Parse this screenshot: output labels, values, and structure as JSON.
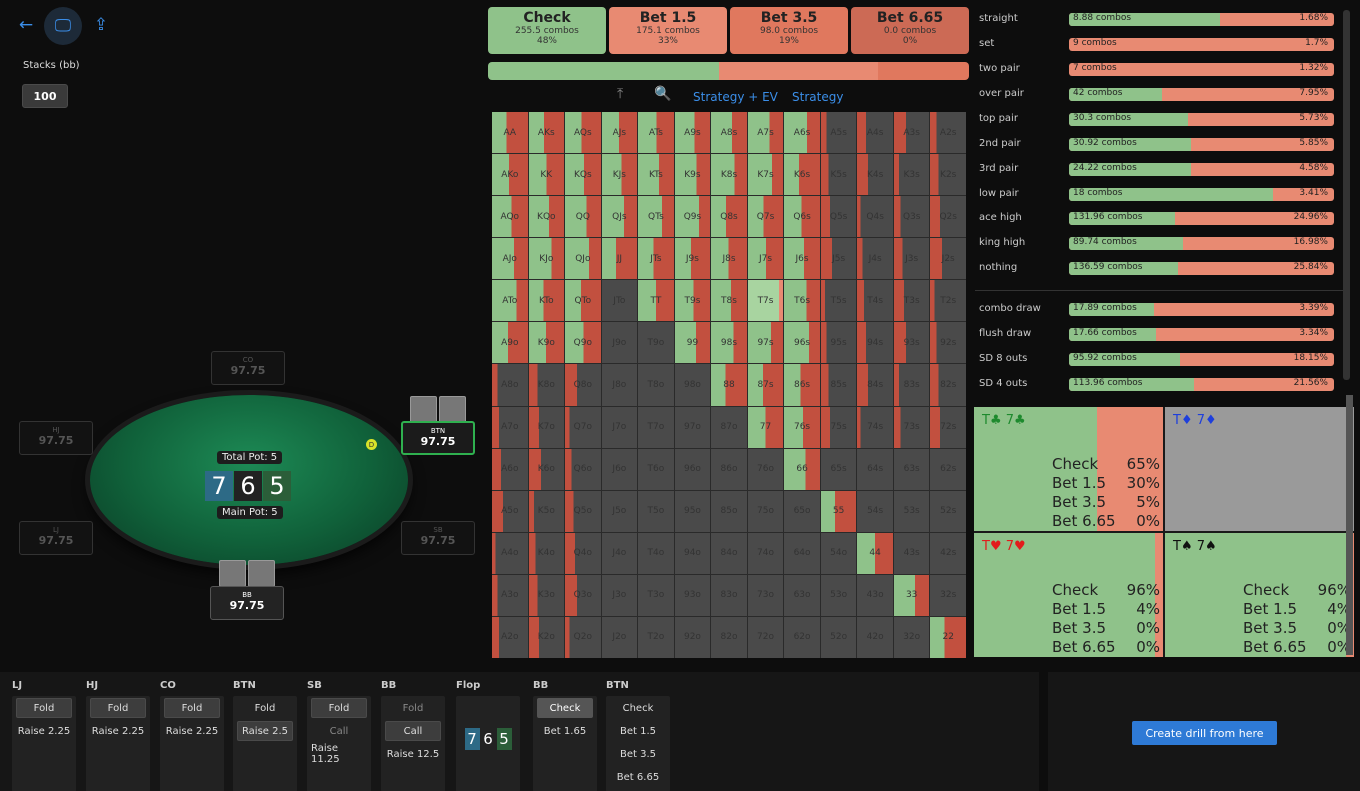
{
  "toolbar": {
    "back_icon": "←",
    "monitor_icon": "🖵",
    "export_icon": "⇪"
  },
  "stacks": {
    "label": "Stacks (bb)",
    "value": "100"
  },
  "table": {
    "total_pot": "Total Pot: 5",
    "main_pot": "Main Pot: 5",
    "board": [
      "7",
      "6",
      "5"
    ],
    "board_colors": [
      "#2d6a86",
      "#222",
      "#2b5e39"
    ],
    "dealer_icon": "D",
    "seats": [
      {
        "name": "CO",
        "stack": "97.75"
      },
      {
        "name": "HJ",
        "stack": "97.75"
      },
      {
        "name": "BTN",
        "stack": "97.75"
      },
      {
        "name": "LJ",
        "stack": "97.75"
      },
      {
        "name": "SB",
        "stack": "97.75"
      },
      {
        "name": "BB",
        "stack": "97.75"
      }
    ]
  },
  "actions": [
    {
      "name": "Check",
      "combos": "255.5 combos",
      "pct": "48%",
      "color": "#8fc28a"
    },
    {
      "name": "Bet 1.5",
      "combos": "175.1 combos",
      "pct": "33%",
      "color": "#e88a72"
    },
    {
      "name": "Bet 3.5",
      "combos": "98.0 combos",
      "pct": "19%",
      "color": "#e0785e"
    },
    {
      "name": "Bet 6.65",
      "combos": "0.0 combos",
      "pct": "0%",
      "color": "#cc6a55"
    }
  ],
  "strategy_bar": [
    0.48,
    0.33,
    0.19,
    0.0
  ],
  "view_tabs": {
    "pin_icon": "⤒",
    "zoom_icon": "🔍",
    "strategy_ev": "Strategy + EV",
    "strategy": "Strategy"
  },
  "matrix": {
    "ranks": [
      "A",
      "K",
      "Q",
      "J",
      "T",
      "9",
      "8",
      "7",
      "6",
      "5",
      "4",
      "3",
      "2"
    ],
    "green": "#8fc28a",
    "red": "#c2503f",
    "grey": "#4a4a4a"
  },
  "stats": [
    {
      "name": "straight",
      "combos": "8.88 combos",
      "pct": "1.68%",
      "check": 0.57
    },
    {
      "name": "set",
      "combos": "9 combos",
      "pct": "1.7%",
      "check": 0.0
    },
    {
      "name": "two pair",
      "combos": "7 combos",
      "pct": "1.32%",
      "check": 0.0
    },
    {
      "name": "over pair",
      "combos": "42 combos",
      "pct": "7.95%",
      "check": 0.35
    },
    {
      "name": "top pair",
      "combos": "30.3 combos",
      "pct": "5.73%",
      "check": 0.45
    },
    {
      "name": "2nd pair",
      "combos": "30.92 combos",
      "pct": "5.85%",
      "check": 0.46
    },
    {
      "name": "3rd pair",
      "combos": "24.22 combos",
      "pct": "4.58%",
      "check": 0.46
    },
    {
      "name": "low pair",
      "combos": "18 combos",
      "pct": "3.41%",
      "check": 0.77
    },
    {
      "name": "ace high",
      "combos": "131.96 combos",
      "pct": "24.96%",
      "check": 0.4
    },
    {
      "name": "king high",
      "combos": "89.74 combos",
      "pct": "16.98%",
      "check": 0.43
    },
    {
      "name": "nothing",
      "combos": "136.59 combos",
      "pct": "25.84%",
      "check": 0.41
    },
    {
      "name": "combo draw",
      "combos": "17.89 combos",
      "pct": "3.39%",
      "check": 0.32
    },
    {
      "name": "flush draw",
      "combos": "17.66 combos",
      "pct": "3.34%",
      "check": 0.33
    },
    {
      "name": "SD 8 outs",
      "combos": "95.92 combos",
      "pct": "18.15%",
      "check": 0.42
    },
    {
      "name": "SD 4 outs",
      "combos": "113.96 combos",
      "pct": "21.56%",
      "check": 0.47
    }
  ],
  "combo_detail": [
    {
      "rank1": "T",
      "rank2": "7",
      "suit": "♣",
      "color": "#1e8a2e",
      "lines": [
        {
          "a": "Check",
          "p": "65%"
        },
        {
          "a": "Bet 1.5",
          "p": "30%"
        },
        {
          "a": "Bet 3.5",
          "p": "5%"
        },
        {
          "a": "Bet 6.65",
          "p": "0%"
        }
      ],
      "red": 0.35,
      "grey": false
    },
    {
      "rank1": "T",
      "rank2": "7",
      "suit": "♦",
      "color": "#1e3fdc",
      "lines": [],
      "red": 0,
      "grey": true
    },
    {
      "rank1": "T",
      "rank2": "7",
      "suit": "♥",
      "color": "#e21c1c",
      "lines": [
        {
          "a": "Check",
          "p": "96%"
        },
        {
          "a": "Bet 1.5",
          "p": "4%"
        },
        {
          "a": "Bet 3.5",
          "p": "0%"
        },
        {
          "a": "Bet 6.65",
          "p": "0%"
        }
      ],
      "red": 0.04,
      "grey": false
    },
    {
      "rank1": "T",
      "rank2": "7",
      "suit": "♠",
      "color": "#111",
      "lines": [
        {
          "a": "Check",
          "p": "96%"
        },
        {
          "a": "Bet 1.5",
          "p": "4%"
        },
        {
          "a": "Bet 3.5",
          "p": "0%"
        },
        {
          "a": "Bet 6.65",
          "p": "0%"
        }
      ],
      "red": 0.04,
      "grey": false
    }
  ],
  "history": [
    {
      "pos": "LJ",
      "opts": [
        {
          "t": "Fold",
          "s": "sel"
        },
        {
          "t": "Raise 2.25",
          "s": ""
        }
      ]
    },
    {
      "pos": "HJ",
      "opts": [
        {
          "t": "Fold",
          "s": "sel"
        },
        {
          "t": "Raise 2.25",
          "s": ""
        }
      ]
    },
    {
      "pos": "CO",
      "opts": [
        {
          "t": "Fold",
          "s": "sel"
        },
        {
          "t": "Raise 2.25",
          "s": ""
        }
      ]
    },
    {
      "pos": "BTN",
      "opts": [
        {
          "t": "Fold",
          "s": ""
        },
        {
          "t": "Raise 2.5",
          "s": "sel"
        }
      ]
    },
    {
      "pos": "SB",
      "opts": [
        {
          "t": "Fold",
          "s": "sel"
        },
        {
          "t": "Call",
          "s": "dim"
        },
        {
          "t": "Raise 11.25",
          "s": ""
        }
      ]
    },
    {
      "pos": "BB",
      "opts": [
        {
          "t": "Fold",
          "s": "dim"
        },
        {
          "t": "Call",
          "s": "sel"
        },
        {
          "t": "Raise 12.5",
          "s": ""
        }
      ]
    },
    {
      "pos": "Flop",
      "opts": []
    },
    {
      "pos": "BB",
      "opts": [
        {
          "t": "Check",
          "s": "hi"
        },
        {
          "t": "Bet 1.65",
          "s": ""
        }
      ]
    },
    {
      "pos": "BTN",
      "opts": [
        {
          "t": "Check",
          "s": ""
        },
        {
          "t": "Bet 1.5",
          "s": ""
        },
        {
          "t": "Bet 3.5",
          "s": ""
        },
        {
          "t": "Bet 6.65",
          "s": ""
        }
      ]
    }
  ],
  "drill_button": "Create drill from here"
}
